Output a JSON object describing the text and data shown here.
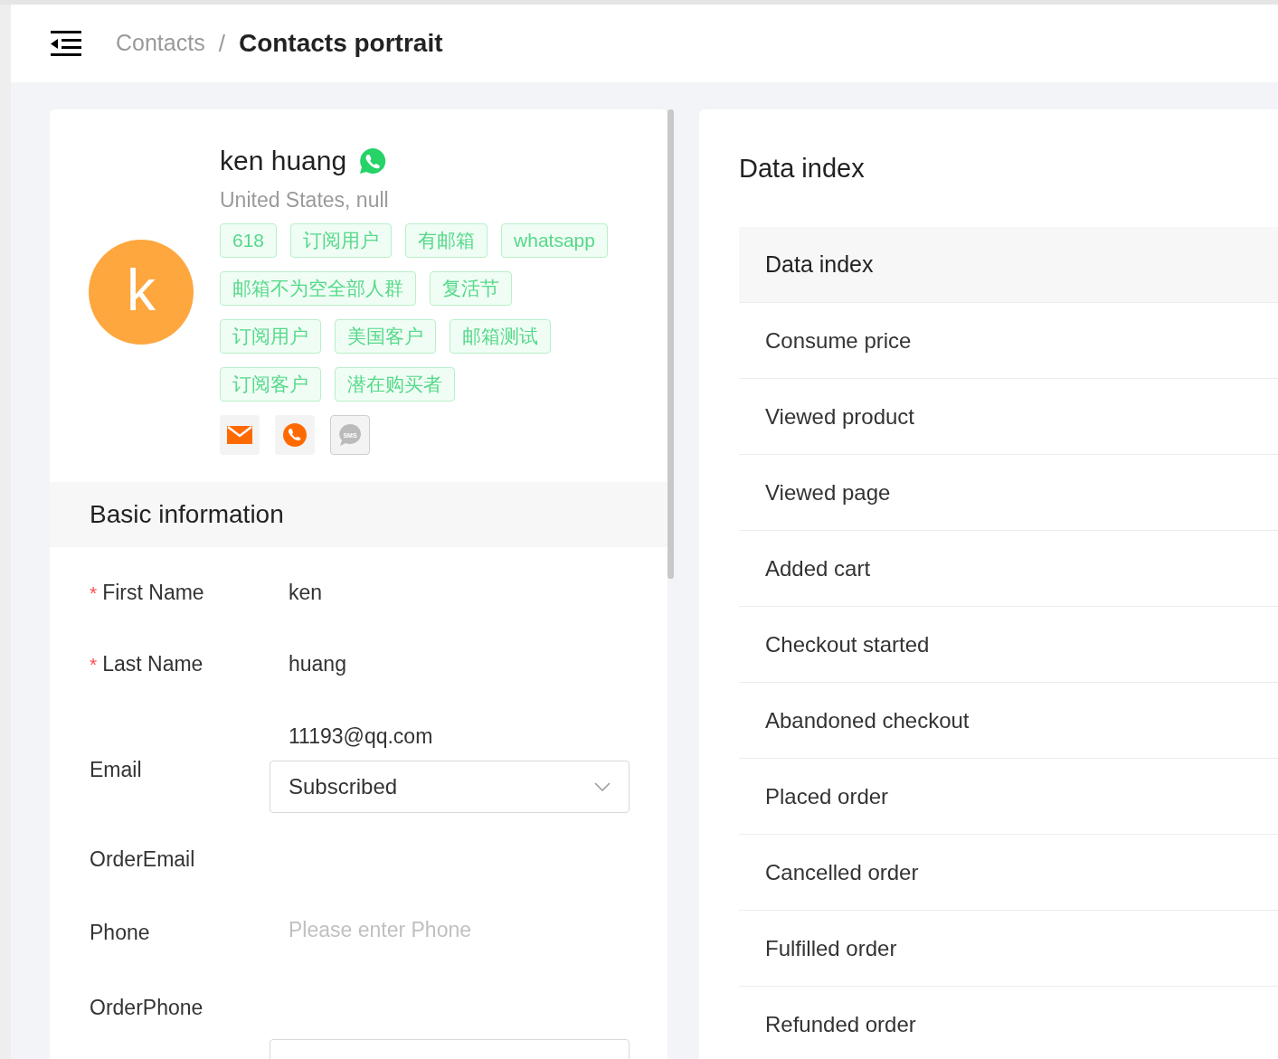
{
  "breadcrumb": [
    {
      "label": "Contacts",
      "current": false
    },
    {
      "label": "Contacts portrait",
      "current": true
    }
  ],
  "separator": "/",
  "profile": {
    "avatar_letter": "k",
    "name": "ken huang",
    "location": "United States, null",
    "tags": [
      "618",
      "订阅用户",
      "有邮箱",
      "whatsapp",
      "邮箱不为空全部人群",
      "复活节",
      "订阅用户",
      "美国客户",
      "邮箱测试",
      "订阅客户",
      "潜在购买者"
    ],
    "channels": [
      {
        "kind": "email",
        "active": true
      },
      {
        "kind": "phone",
        "active": true
      },
      {
        "kind": "sms",
        "active": false,
        "label": "SMS"
      }
    ]
  },
  "basic_information": {
    "title": "Basic information",
    "required_mark": "*",
    "fields": [
      {
        "label": "First Name",
        "required": true,
        "kind": "text",
        "value": "ken"
      },
      {
        "label": "Last Name",
        "required": true,
        "kind": "text",
        "value": "huang"
      },
      {
        "label": "Email",
        "required": false,
        "kind": "email",
        "value": "11193@qq.com",
        "status": "Subscribed"
      },
      {
        "label": "OrderEmail",
        "required": false,
        "kind": "empty"
      },
      {
        "label": "Phone",
        "required": false,
        "kind": "input",
        "placeholder": "Please enter Phone"
      },
      {
        "label": "OrderPhone",
        "required": false,
        "kind": "empty_select"
      }
    ]
  },
  "data_index": {
    "title": "Data index",
    "column": "Data index",
    "rows": [
      "Consume price",
      "Viewed product",
      "Viewed page",
      "Added cart",
      "Checkout started",
      "Abandoned checkout",
      "Placed order",
      "Cancelled order",
      "Fulfilled order",
      "Refunded order"
    ]
  }
}
